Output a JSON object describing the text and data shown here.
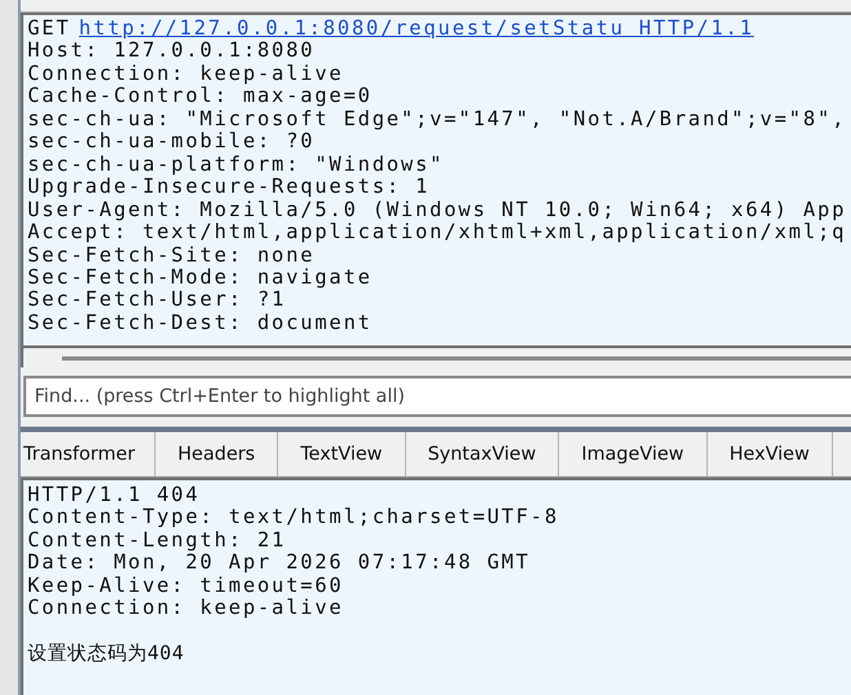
{
  "request": {
    "method": "GET",
    "link": "http://127.0.0.1:8080/request/setStatu HTTP/1.1",
    "headers": [
      "Host: 127.0.0.1:8080",
      "Connection: keep-alive",
      "Cache-Control: max-age=0",
      "sec-ch-ua: \"Microsoft Edge\";v=\"147\", \"Not.A/Brand\";v=\"8\",",
      "sec-ch-ua-mobile: ?0",
      "sec-ch-ua-platform: \"Windows\"",
      "Upgrade-Insecure-Requests: 1",
      "User-Agent: Mozilla/5.0 (Windows NT 10.0; Win64; x64) App",
      "Accept: text/html,application/xhtml+xml,application/xml;q",
      "Sec-Fetch-Site: none",
      "Sec-Fetch-Mode: navigate",
      "Sec-Fetch-User: ?1",
      "Sec-Fetch-Dest: document"
    ]
  },
  "find": {
    "placeholder": "Find... (press Ctrl+Enter to highlight all)"
  },
  "tabs": [
    {
      "label": "Transformer",
      "selected": false
    },
    {
      "label": "Headers",
      "selected": false
    },
    {
      "label": "TextView",
      "selected": false
    },
    {
      "label": "SyntaxView",
      "selected": false
    },
    {
      "label": "ImageView",
      "selected": false
    },
    {
      "label": "HexView",
      "selected": false
    }
  ],
  "response": {
    "headers": [
      "HTTP/1.1 404",
      "Content-Type: text/html;charset=UTF-8",
      "Content-Length: 21",
      "Date: Mon, 20 Apr 2026 07:17:48 GMT",
      "Keep-Alive: timeout=60",
      "Connection: keep-alive"
    ],
    "body": "设置状态码为404"
  }
}
